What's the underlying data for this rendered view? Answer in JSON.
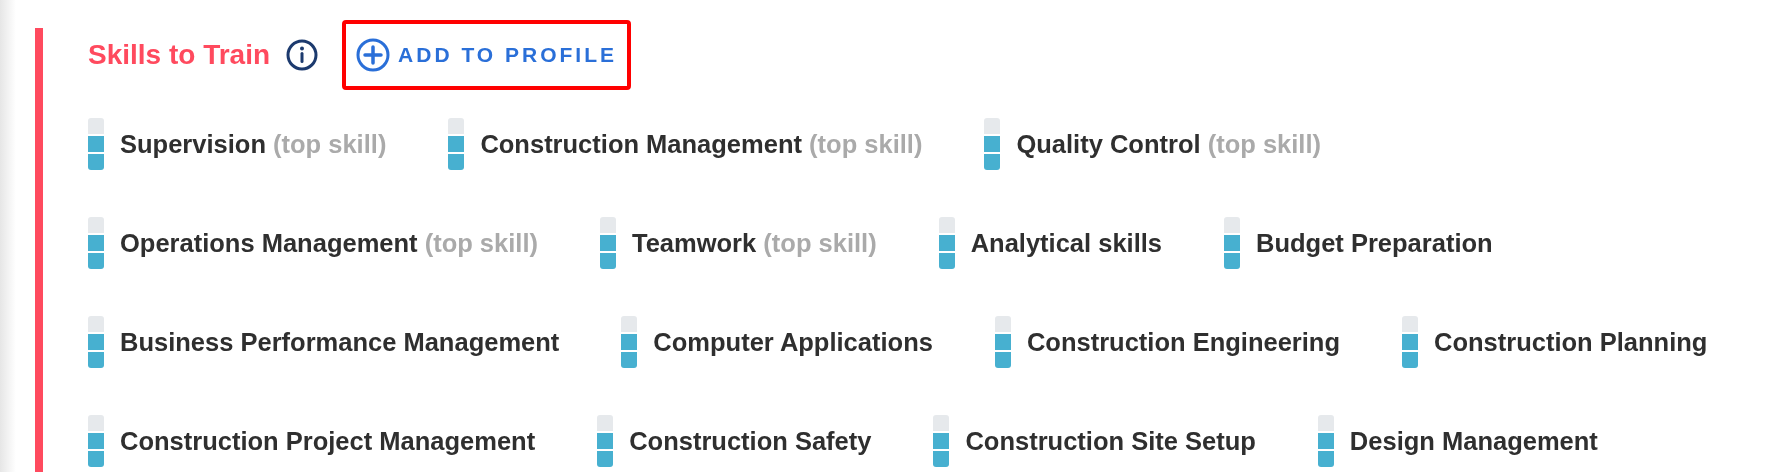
{
  "section": {
    "title": "Skills to Train",
    "action": {
      "label": "ADD TO PROFILE",
      "highlighted": true
    }
  },
  "rows": [
    [
      {
        "name": "Supervision",
        "note": "(top skill)",
        "level": 0.67
      },
      {
        "name": "Construction Management",
        "note": "(top skill)",
        "level": 0.67
      },
      {
        "name": "Quality Control",
        "note": "(top skill)",
        "level": 0.67
      }
    ],
    [
      {
        "name": "Operations Management",
        "note": "(top skill)",
        "level": 0.67
      },
      {
        "name": "Teamwork",
        "note": "(top skill)",
        "level": 0.67
      },
      {
        "name": "Analytical skills",
        "level": 0.67
      },
      {
        "name": "Budget Preparation",
        "level": 0.67
      }
    ],
    [
      {
        "name": "Business Performance Management",
        "level": 0.67
      },
      {
        "name": "Computer Applications",
        "level": 0.67
      },
      {
        "name": "Construction Engineering",
        "level": 0.67
      },
      {
        "name": "Construction Planning",
        "level": 0.67
      }
    ],
    [
      {
        "name": "Construction Project Management",
        "level": 0.67
      },
      {
        "name": "Construction Safety",
        "level": 0.67
      },
      {
        "name": "Construction Site Setup",
        "level": 0.67
      },
      {
        "name": "Design Management",
        "level": 0.67
      }
    ]
  ]
}
